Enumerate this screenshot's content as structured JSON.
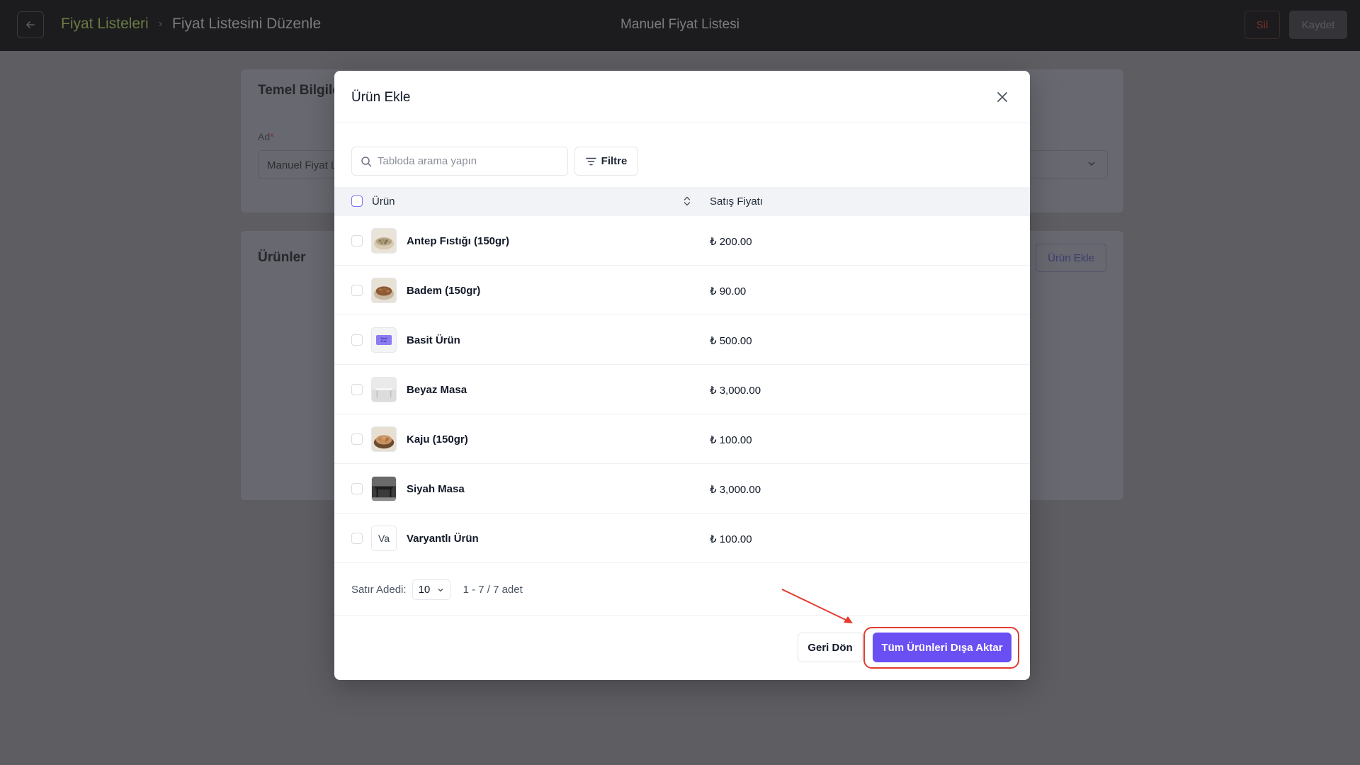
{
  "topbar": {
    "breadcrumb": [
      "Fiyat Listeleri",
      "Fiyat Listesini Düzenle"
    ],
    "title": "Manuel Fiyat Listesi",
    "delete_label": "Sil",
    "save_label": "Kaydet"
  },
  "background": {
    "section_basic": "Temel Bilgiler",
    "name_label": "Ad",
    "name_required": "*",
    "name_value": "Manuel Fiyat Listesi",
    "section_products": "Ürünler",
    "add_product_label": "Ürün Ekle"
  },
  "modal": {
    "title": "Ürün Ekle",
    "search_placeholder": "Tabloda arama yapın",
    "filter_label": "Filtre",
    "columns": {
      "product": "Ürün",
      "price": "Satış Fiyatı"
    },
    "rows": [
      {
        "name": "Antep Fıstığı (150gr)",
        "price": "₺ 200.00",
        "thumb": "pistachio"
      },
      {
        "name": "Badem (150gr)",
        "price": "₺ 90.00",
        "thumb": "almond"
      },
      {
        "name": "Basit Ürün",
        "price": "₺ 500.00",
        "thumb": "basic",
        "thumb_text": "Basit Ürün"
      },
      {
        "name": "Beyaz Masa",
        "price": "₺ 3,000.00",
        "thumb": "white-table"
      },
      {
        "name": "Kaju (150gr)",
        "price": "₺ 100.00",
        "thumb": "cashew"
      },
      {
        "name": "Siyah Masa",
        "price": "₺ 3,000.00",
        "thumb": "black-table"
      },
      {
        "name": "Varyantlı Ürün",
        "price": "₺ 100.00",
        "thumb": "initials",
        "thumb_text": "Va"
      }
    ],
    "pagination": {
      "rows_label": "Satır Adedi:",
      "page_size": "10",
      "range": "1 - 7 / 7 adet"
    },
    "back_label": "Geri Dön",
    "export_label": "Tüm Ürünleri Dışa Aktar"
  },
  "colors": {
    "accent": "#6a4ff3",
    "annotation": "#e43b2f"
  }
}
